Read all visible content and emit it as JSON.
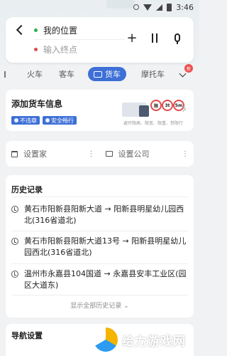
{
  "status_bar": {
    "time": "3:46"
  },
  "search": {
    "from_label": "我的位置",
    "to_placeholder": "输入终点"
  },
  "tabs": [
    {
      "label": "火车"
    },
    {
      "label": "客车"
    },
    {
      "label": "货车"
    },
    {
      "label": "摩托车"
    }
  ],
  "new_badge": "新",
  "truck_info": {
    "title": "添加货车信息",
    "chips": [
      "不违章",
      "安全畅行"
    ],
    "signs": [
      "限",
      "3t",
      "5m"
    ],
    "caption": "避开限高、限宽、限重、禁限行"
  },
  "places": {
    "home": "设置家",
    "company": "设置公司"
  },
  "history": {
    "title": "历史记录",
    "items": [
      "黄石市阳新县阳新大道 → 阳新县明星幼儿园西北(316省道北)",
      "黄石市阳新县阳新大道13号 → 阳新县明星幼儿园西北(316省道北)",
      "温州市永嘉县104国道 → 永嘉县安丰工业区(园区大道东)"
    ],
    "show_all": "显示全部历史记录"
  },
  "nav_settings": {
    "title": "导航设置"
  },
  "watermark": {
    "text": "给力游戏网"
  },
  "colors": {
    "accent": "#3d6fd6",
    "badge": "#ef4f4f",
    "start_dot": "#2bb24c",
    "end_dot": "#e24b4b"
  }
}
